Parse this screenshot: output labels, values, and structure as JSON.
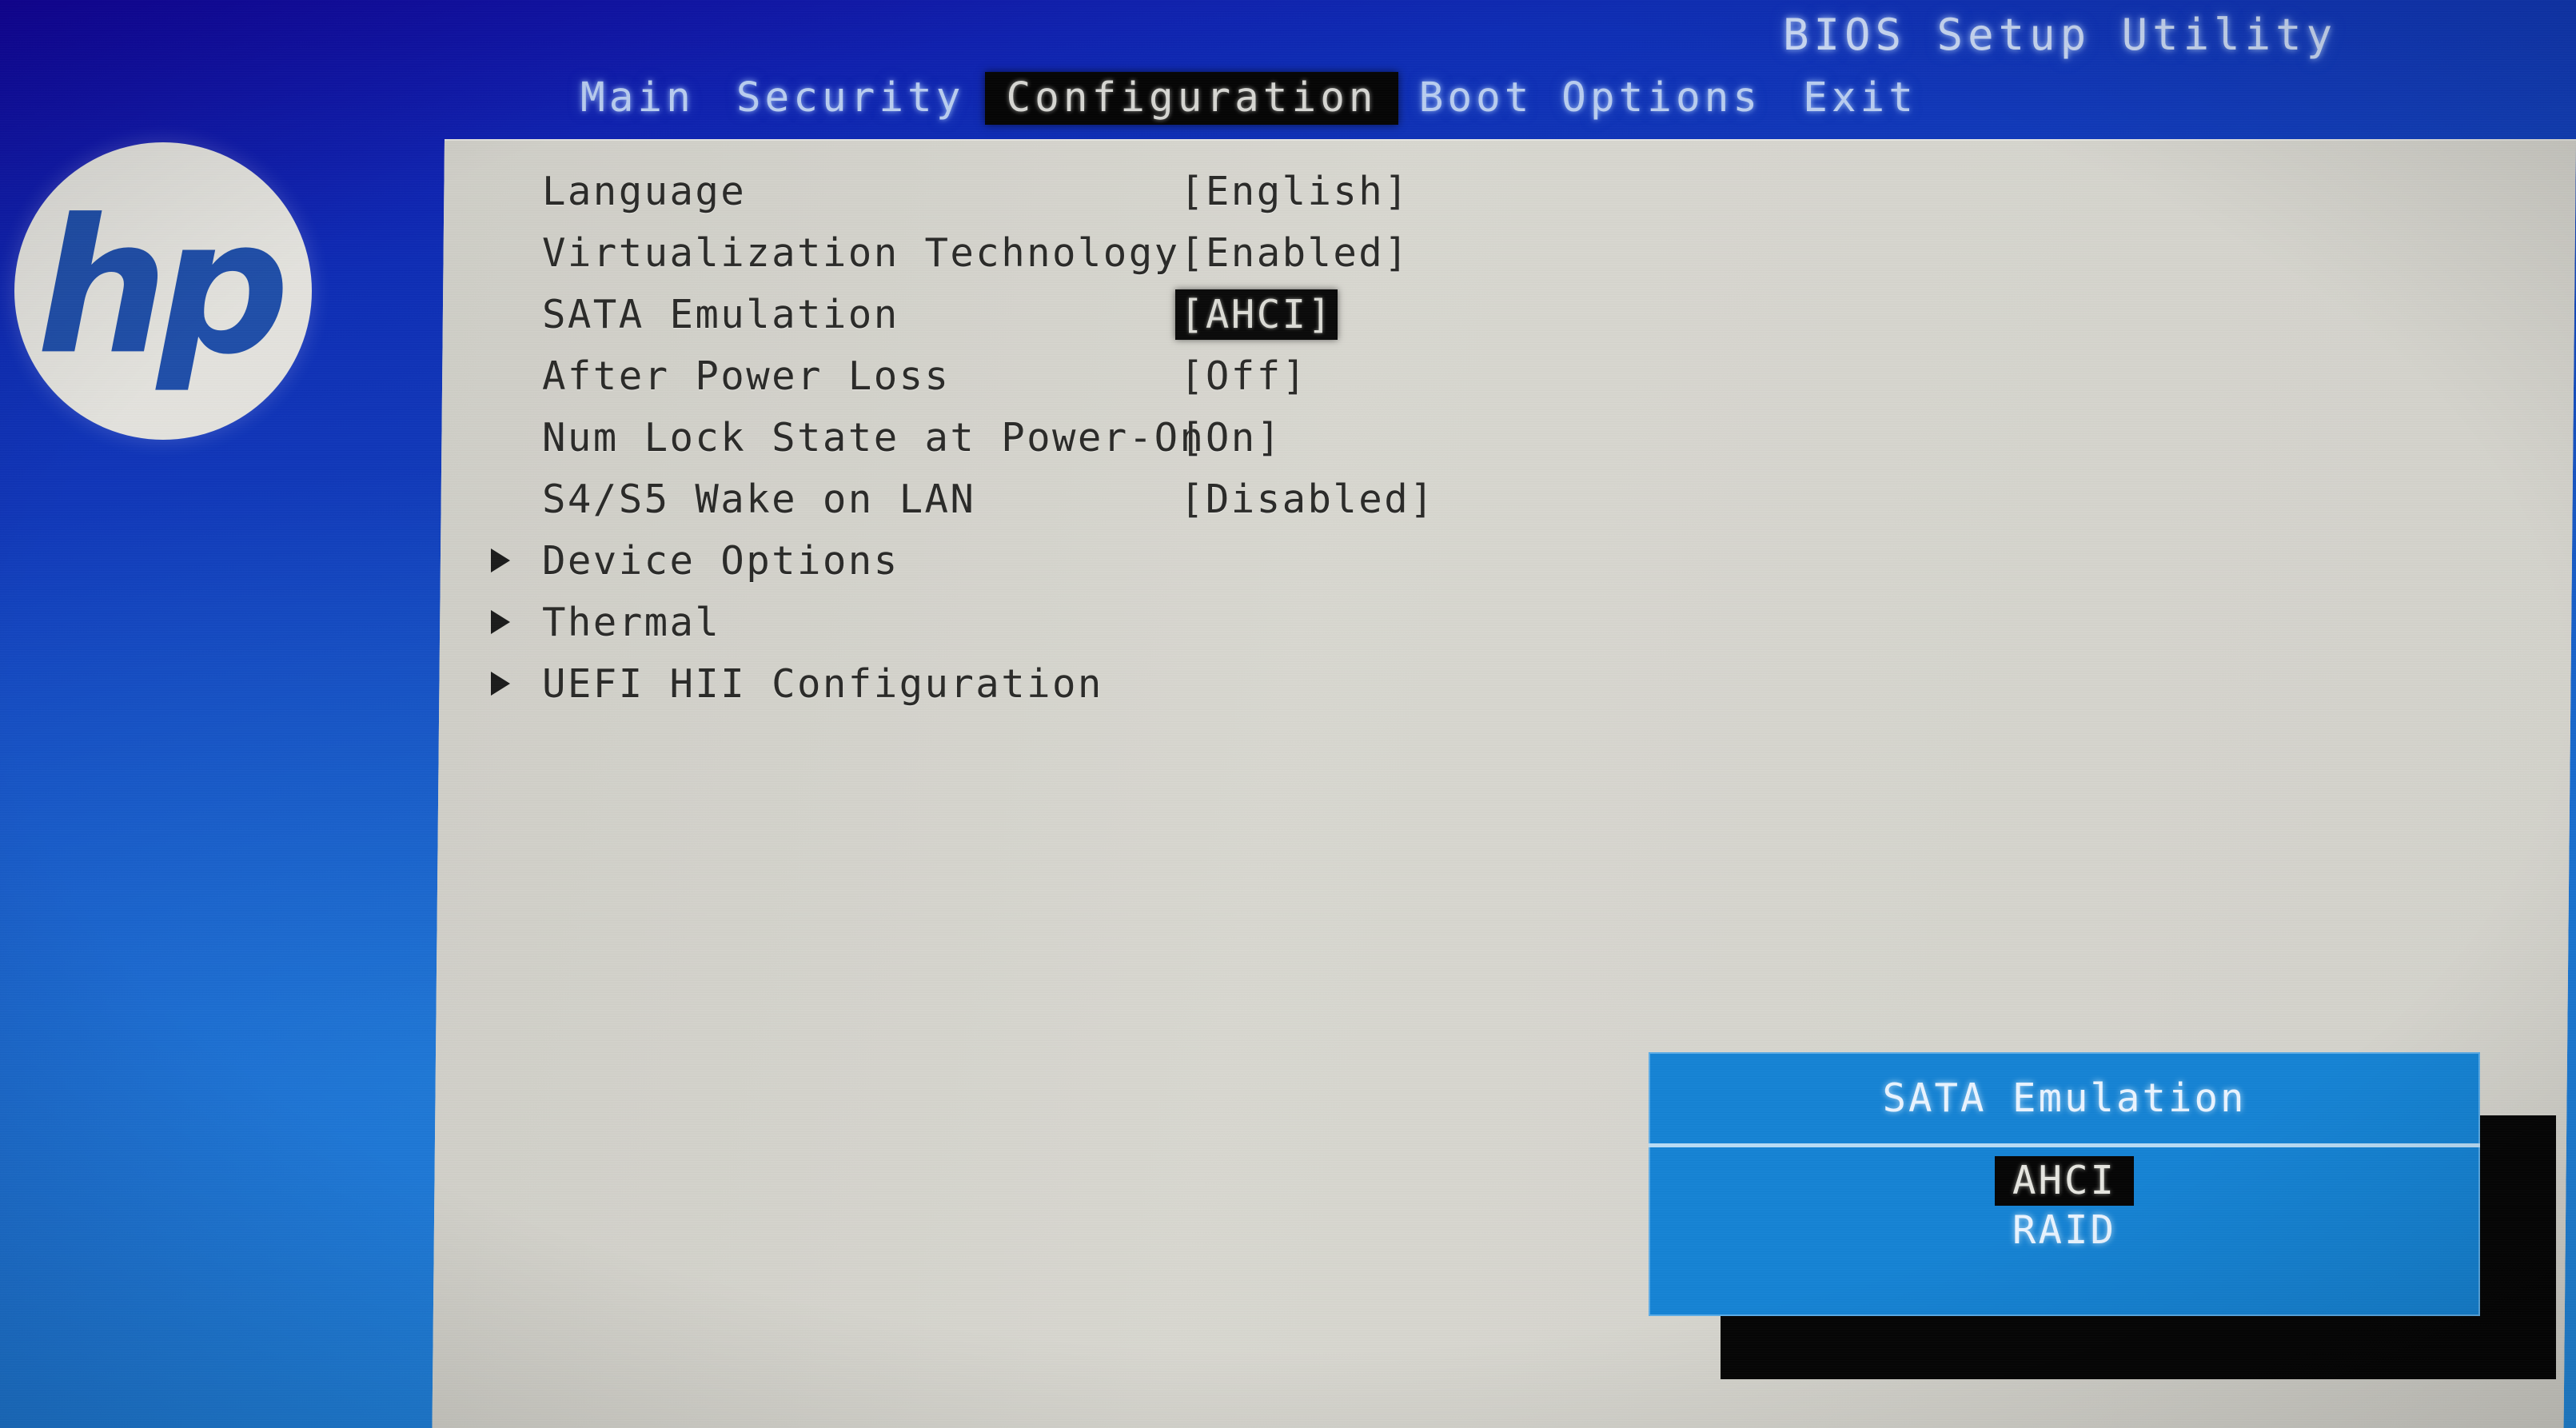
{
  "app": {
    "title": "BIOS Setup Utility",
    "vendor_logo": "hp-logo",
    "logo_text": "hp"
  },
  "menu": {
    "tabs": [
      {
        "label": "Main",
        "active": false
      },
      {
        "label": "Security",
        "active": false
      },
      {
        "label": "Configuration",
        "active": true
      },
      {
        "label": "Boot Options",
        "active": false
      },
      {
        "label": "Exit",
        "active": false
      }
    ]
  },
  "settings": [
    {
      "label": "Language",
      "value": "[English]",
      "selected": false,
      "submenu": false
    },
    {
      "label": "Virtualization Technology",
      "value": "[Enabled]",
      "selected": false,
      "submenu": false
    },
    {
      "label": "SATA Emulation",
      "value": "[AHCI]",
      "selected": true,
      "submenu": false
    },
    {
      "label": "After Power Loss",
      "value": "[Off]",
      "selected": false,
      "submenu": false
    },
    {
      "label": "Num Lock State at Power-On",
      "value": "[On]",
      "selected": false,
      "submenu": false
    },
    {
      "label": "S4/S5 Wake on LAN",
      "value": "[Disabled]",
      "selected": false,
      "submenu": false
    },
    {
      "label": "Device Options",
      "value": "",
      "selected": false,
      "submenu": true
    },
    {
      "label": "Thermal",
      "value": "",
      "selected": false,
      "submenu": true
    },
    {
      "label": "UEFI HII Configuration",
      "value": "",
      "selected": false,
      "submenu": true
    }
  ],
  "popup": {
    "title": "SATA Emulation",
    "options": [
      {
        "label": "AHCI",
        "selected": true
      },
      {
        "label": "RAID",
        "selected": false
      }
    ]
  },
  "colors": {
    "backdrop_blue_top": "#0d2bb0",
    "backdrop_blue_bottom": "#2189dd",
    "panel_gray": "#d5d4cd",
    "popup_blue": "#1583d4",
    "highlight_black": "#0a0a0a",
    "menu_text": "#b9cdf0",
    "logo_blue": "#1f4ea8"
  }
}
